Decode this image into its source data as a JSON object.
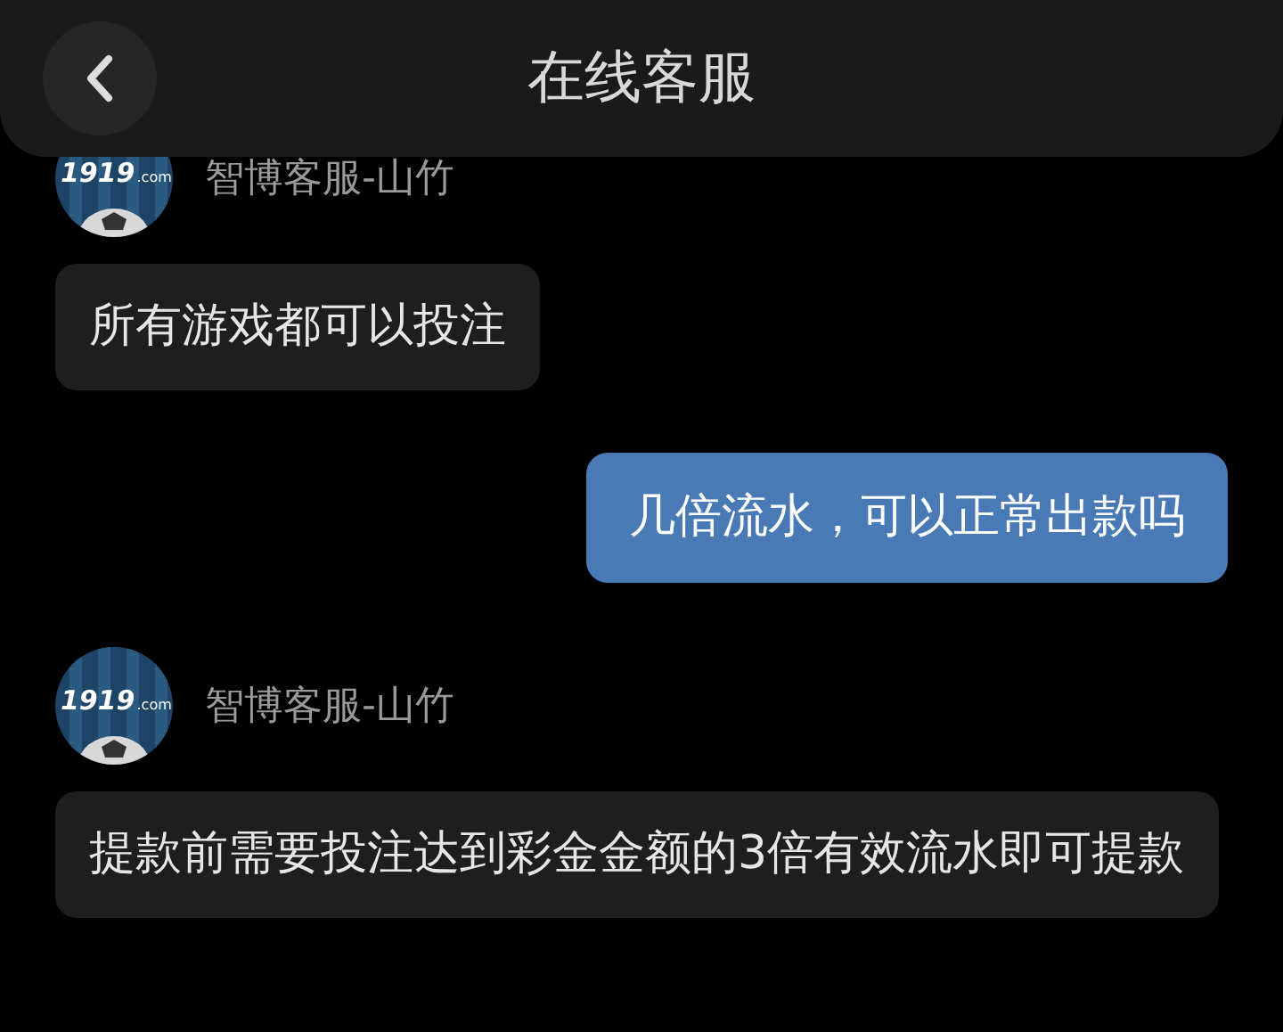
{
  "header": {
    "title": "在线客服"
  },
  "messages": [
    {
      "kind": "agent",
      "sender": "智博客服-山竹",
      "avatar_text": [
        "1919",
        ".com"
      ],
      "text": "所有游戏都可以投注"
    },
    {
      "kind": "user",
      "text": "几倍流水，可以正常出款吗"
    },
    {
      "kind": "agent",
      "sender": "智博客服-山竹",
      "avatar_text": [
        "1919",
        ".com"
      ],
      "text": "提款前需要投注达到彩金金额的3倍有效流水即可提款"
    }
  ]
}
